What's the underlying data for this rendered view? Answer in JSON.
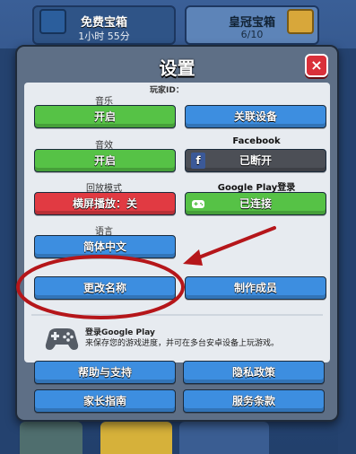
{
  "background": {
    "left_chest_title": "免费宝箱",
    "left_chest_sub": "1小时 55分",
    "right_chest_title": "皇冠宝箱",
    "right_chest_sub": "6/10"
  },
  "dialog": {
    "title": "设置",
    "close_label": "×",
    "player_id": "玩家ID：",
    "music": {
      "label": "音乐",
      "button": "开启"
    },
    "device": {
      "button": "关联设备"
    },
    "sfx": {
      "label": "音效",
      "button": "开启"
    },
    "facebook": {
      "label": "Facebook",
      "button": "已断开"
    },
    "replay": {
      "label": "回放模式",
      "button": "横屏播放：关"
    },
    "google_play_login": {
      "label": "Google Play登录",
      "button": "已连接"
    },
    "language": {
      "label": "语言",
      "button": "简体中文"
    },
    "rename_button": "更改名称",
    "credits_button": "制作成员",
    "google_play_info": {
      "title": "登录Google Play",
      "desc": "来保存您的游戏进度，并可在多台安卓设备上玩游戏。"
    },
    "help_button": "帮助与支持",
    "privacy_button": "隐私政策",
    "parent_button": "家长指南",
    "terms_button": "服务条款"
  },
  "colors": {
    "green": "#56c246",
    "blue": "#3d8ee0",
    "red": "#e13a42",
    "dark": "#4c4f56",
    "annotation": "#b5161a"
  }
}
